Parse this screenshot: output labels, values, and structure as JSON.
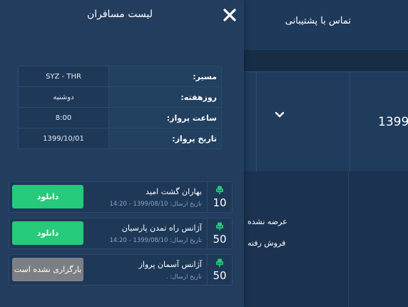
{
  "background": {
    "support_label": "تماس با پشتیبانی",
    "card_year": "1399",
    "stat_not_offered": "عرضه نشده",
    "stat_sold": "فروش رفته"
  },
  "modal": {
    "title": "لیست مسافران",
    "info": [
      {
        "label": "مسیر:",
        "value": "SYZ - THR"
      },
      {
        "label": "روزهفته:",
        "value": "دوشنبه"
      },
      {
        "label": "ساعت پرواز:",
        "value": "8:00"
      },
      {
        "label": "تاریخ پرواز:",
        "value": "1399/10/01"
      }
    ],
    "passengers": [
      {
        "agency": "بهاران گشت امید",
        "sent": "تاریخ ارسال: 1399/08/10 - 14:20",
        "seats": "10",
        "button": "دانلود",
        "status": "download"
      },
      {
        "agency": "آژانس راه تمدن پارسیان",
        "sent": "تاریخ ارسال: 1399/08/10 - 14:20",
        "seats": "50",
        "button": "دانلود",
        "status": "download"
      },
      {
        "agency": "آژانس آسمان پرواز",
        "sent": "تاریخ ارسال: .",
        "seats": "50",
        "button": "بارگزاری نشده است",
        "status": "not-uploaded"
      }
    ]
  },
  "colors": {
    "page_bg": "#1b3350",
    "panel_bg": "#223d5e",
    "accent_green": "#27c97a",
    "disabled_grey": "#7c7f84"
  }
}
